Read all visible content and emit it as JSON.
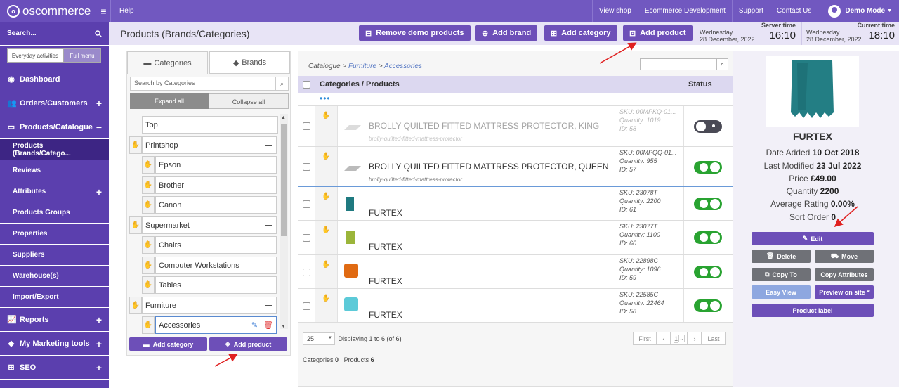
{
  "topbar": {
    "logo_text": "oscommerce",
    "help": "Help",
    "links": [
      "View shop",
      "Ecommerce Development",
      "Support",
      "Contact Us"
    ],
    "user": "Demo Mode"
  },
  "sidebar": {
    "search_label": "Search...",
    "toggle_a": "Everyday activities",
    "toggle_b": "Full menu",
    "items": [
      {
        "label": "Dashboard"
      },
      {
        "label": "Orders/Customers"
      },
      {
        "label": "Products/Catalogue"
      },
      {
        "label": "Products (Brands/Catego..."
      },
      {
        "label": "Reviews"
      },
      {
        "label": "Attributes"
      },
      {
        "label": "Products Groups"
      },
      {
        "label": "Properties"
      },
      {
        "label": "Suppliers"
      },
      {
        "label": "Warehouse(s)"
      },
      {
        "label": "Import/Export"
      },
      {
        "label": "Reports"
      },
      {
        "label": "My Marketing tools"
      },
      {
        "label": "SEO"
      }
    ]
  },
  "header": {
    "title": "Products (Brands/Categories)",
    "remove_demo": "Remove demo products",
    "add_brand": "Add brand",
    "add_category": "Add category",
    "add_product": "Add product",
    "server_label": "Server time",
    "server_day": "Wednesday",
    "server_date": "28 December, 2022",
    "server_time": "16:10",
    "current_label": "Current time",
    "current_day": "Wednesday",
    "current_date": "28 December, 2022",
    "current_time": "18:10"
  },
  "tree": {
    "tab_categories": "Categories",
    "tab_brands": "Brands",
    "search_placeholder": "Search by Categories",
    "expand_all": "Expand all",
    "collapse_all": "Collapse all",
    "nodes": [
      "Top",
      "Printshop",
      "Epson",
      "Brother",
      "Canon",
      "Supermarket",
      "Chairs",
      "Computer Workstations",
      "Tables",
      "Furniture",
      "Accessories"
    ],
    "btn_add_category": "Add category",
    "btn_add_product": "Add product"
  },
  "main": {
    "crumb_root": "Catalogue",
    "crumb_1": "Furniture",
    "crumb_2": "Accessories",
    "col_products": "Categories / Products",
    "col_status": "Status",
    "rows": [
      {
        "name": "BROLLY QUILTED FITTED MATTRESS PROTECTOR, KING",
        "slug": "brolly-quilted-fitted-mattress-protector",
        "sku": "SKU: 00MPKQ-01...",
        "qty": "Quantity: 1019",
        "id": "ID: 58",
        "status": "off"
      },
      {
        "name": "BROLLY QUILTED FITTED MATTRESS PROTECTOR, QUEEN",
        "slug": "brolly-quilted-fitted-mattress-protector",
        "sku": "SKU: 00MPQQ-01...",
        "qty": "Quantity: 955",
        "id": "ID: 57",
        "status": "on"
      },
      {
        "name": "FURTEX",
        "slug": "",
        "sku": "SKU: 23078T",
        "qty": "Quantity: 2200",
        "id": "ID: 61",
        "status": "on"
      },
      {
        "name": "FURTEX",
        "slug": "",
        "sku": "SKU: 23077T",
        "qty": "Quantity: 1100",
        "id": "ID: 60",
        "status": "on"
      },
      {
        "name": "FURTEX",
        "slug": "",
        "sku": "SKU: 22898C",
        "qty": "Quantity: 1096",
        "id": "ID: 59",
        "status": "on"
      },
      {
        "name": "FURTEX",
        "slug": "",
        "sku": "SKU: 22585C",
        "qty": "Quantity: 22464",
        "id": "ID: 58",
        "status": "on"
      }
    ],
    "per_page": "25",
    "displaying": "Displaying 1 to 6 (of 6)",
    "pager_first": "First",
    "pager_page": "1",
    "pager_last": "Last",
    "categories_label": "Categories",
    "categories_count": "0",
    "products_label": "Products",
    "products_count": "6"
  },
  "detail": {
    "name": "FURTEX",
    "date_added_label": "Date Added",
    "date_added": "10 Oct 2018",
    "last_modified_label": "Last Modified",
    "last_modified": "23 Jul 2022",
    "price_label": "Price",
    "price": "£49.00",
    "quantity_label": "Quantity",
    "quantity": "2200",
    "rating_label": "Average Rating",
    "rating": "0.00%",
    "sort_label": "Sort Order",
    "sort": "0",
    "btn_edit": "Edit",
    "btn_delete": "Delete",
    "btn_move": "Move",
    "btn_copy": "Copy To",
    "btn_copy_attr": "Copy Attributes",
    "btn_easy": "Easy View",
    "btn_preview": "Preview on site *",
    "btn_label": "Product label"
  },
  "colors": {
    "accent": "#6d4fb8",
    "sidebar": "#5b3fae",
    "toggle_on": "#29a331",
    "arrow": "#e02020"
  }
}
